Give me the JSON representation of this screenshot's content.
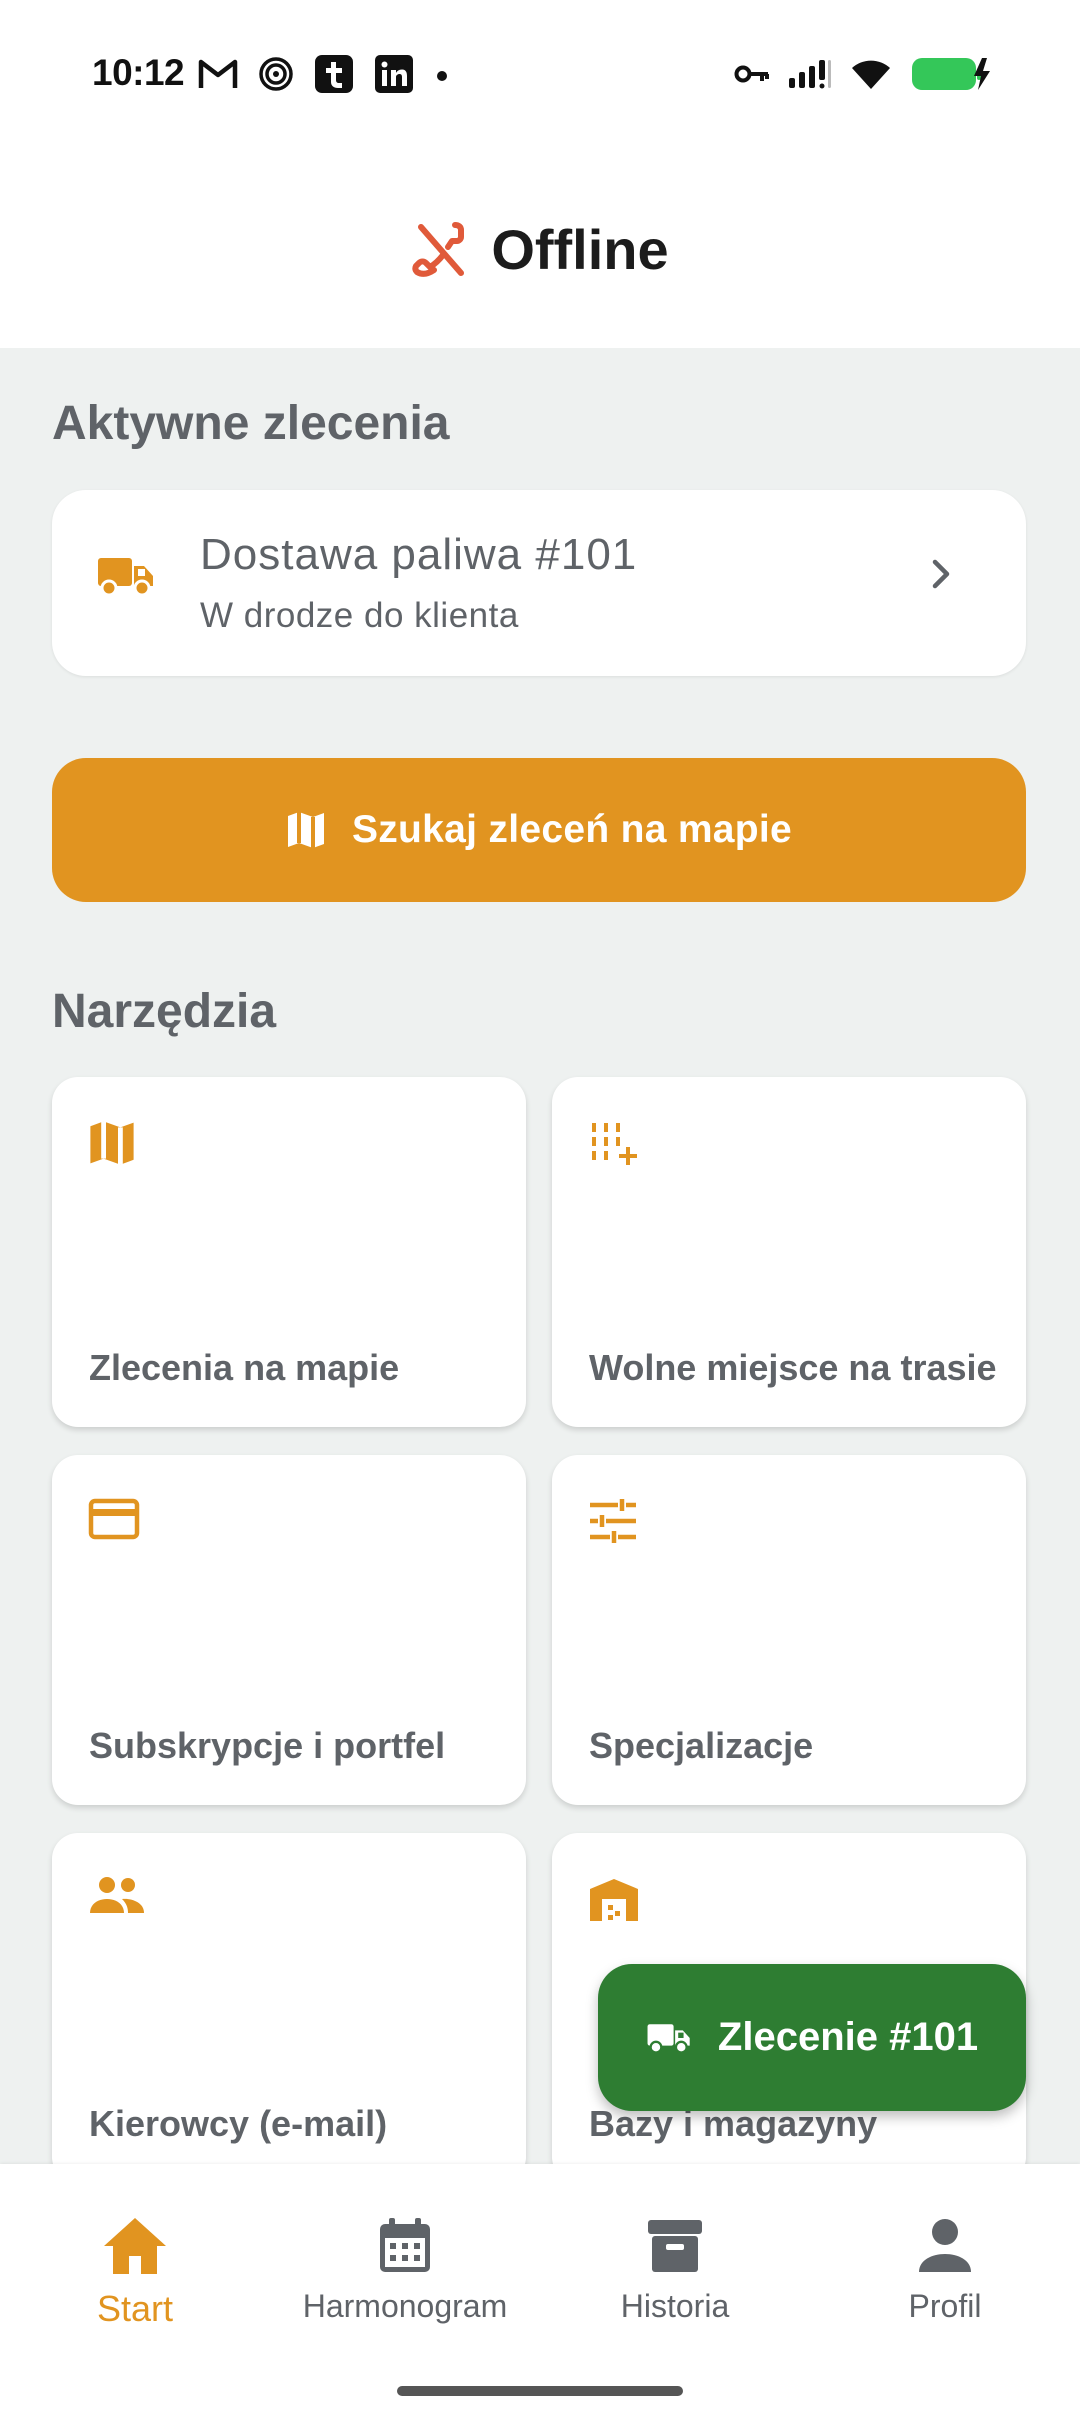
{
  "status_bar": {
    "time": "10:12",
    "left_icons": [
      "gmail-icon",
      "spiral-app-icon",
      "tumblr-icon",
      "linkedin-icon",
      "dot-icon"
    ],
    "right_icons": [
      "vpn-key-icon",
      "signal-icon",
      "wifi-icon",
      "battery-charging-icon"
    ],
    "battery_color": "#34c759"
  },
  "header": {
    "icon": "phone-disabled-icon",
    "title": "Offline",
    "icon_color": "#e05a3a"
  },
  "active_orders": {
    "section_title": "Aktywne zlecenia",
    "items": [
      {
        "icon": "truck-icon",
        "title": "Dostawa paliwa #101",
        "subtitle": "W drodze do klienta"
      }
    ]
  },
  "search_map_button": {
    "icon": "map-icon",
    "label": "Szukaj zleceń na mapie"
  },
  "tools": {
    "section_title": "Narzędzia",
    "tiles": [
      {
        "icon": "map-icon",
        "label": "Zlecenia na mapie"
      },
      {
        "icon": "playlist-add-icon",
        "label": "Wolne miejsce na trasie"
      },
      {
        "icon": "credit-card-icon",
        "label": "Subskrypcje i portfel"
      },
      {
        "icon": "tune-icon",
        "label": "Specjalizacje"
      },
      {
        "icon": "group-icon",
        "label": "Kierowcy (e-mail)"
      },
      {
        "icon": "warehouse-icon",
        "label": "Bazy i magazyny"
      }
    ]
  },
  "fab": {
    "icon": "truck-icon",
    "label": "Zlecenie #101"
  },
  "bottom_nav": {
    "items": [
      {
        "icon": "home-icon",
        "label": "Start",
        "active": true
      },
      {
        "icon": "calendar-icon",
        "label": "Harmonogram",
        "active": false
      },
      {
        "icon": "archive-icon",
        "label": "Historia",
        "active": false
      },
      {
        "icon": "person-icon",
        "label": "Profil",
        "active": false
      }
    ]
  },
  "colors": {
    "accent": "#e19420",
    "fab_green": "#2e7d32",
    "background": "#eef1f0",
    "text_gray": "#5f6368"
  }
}
